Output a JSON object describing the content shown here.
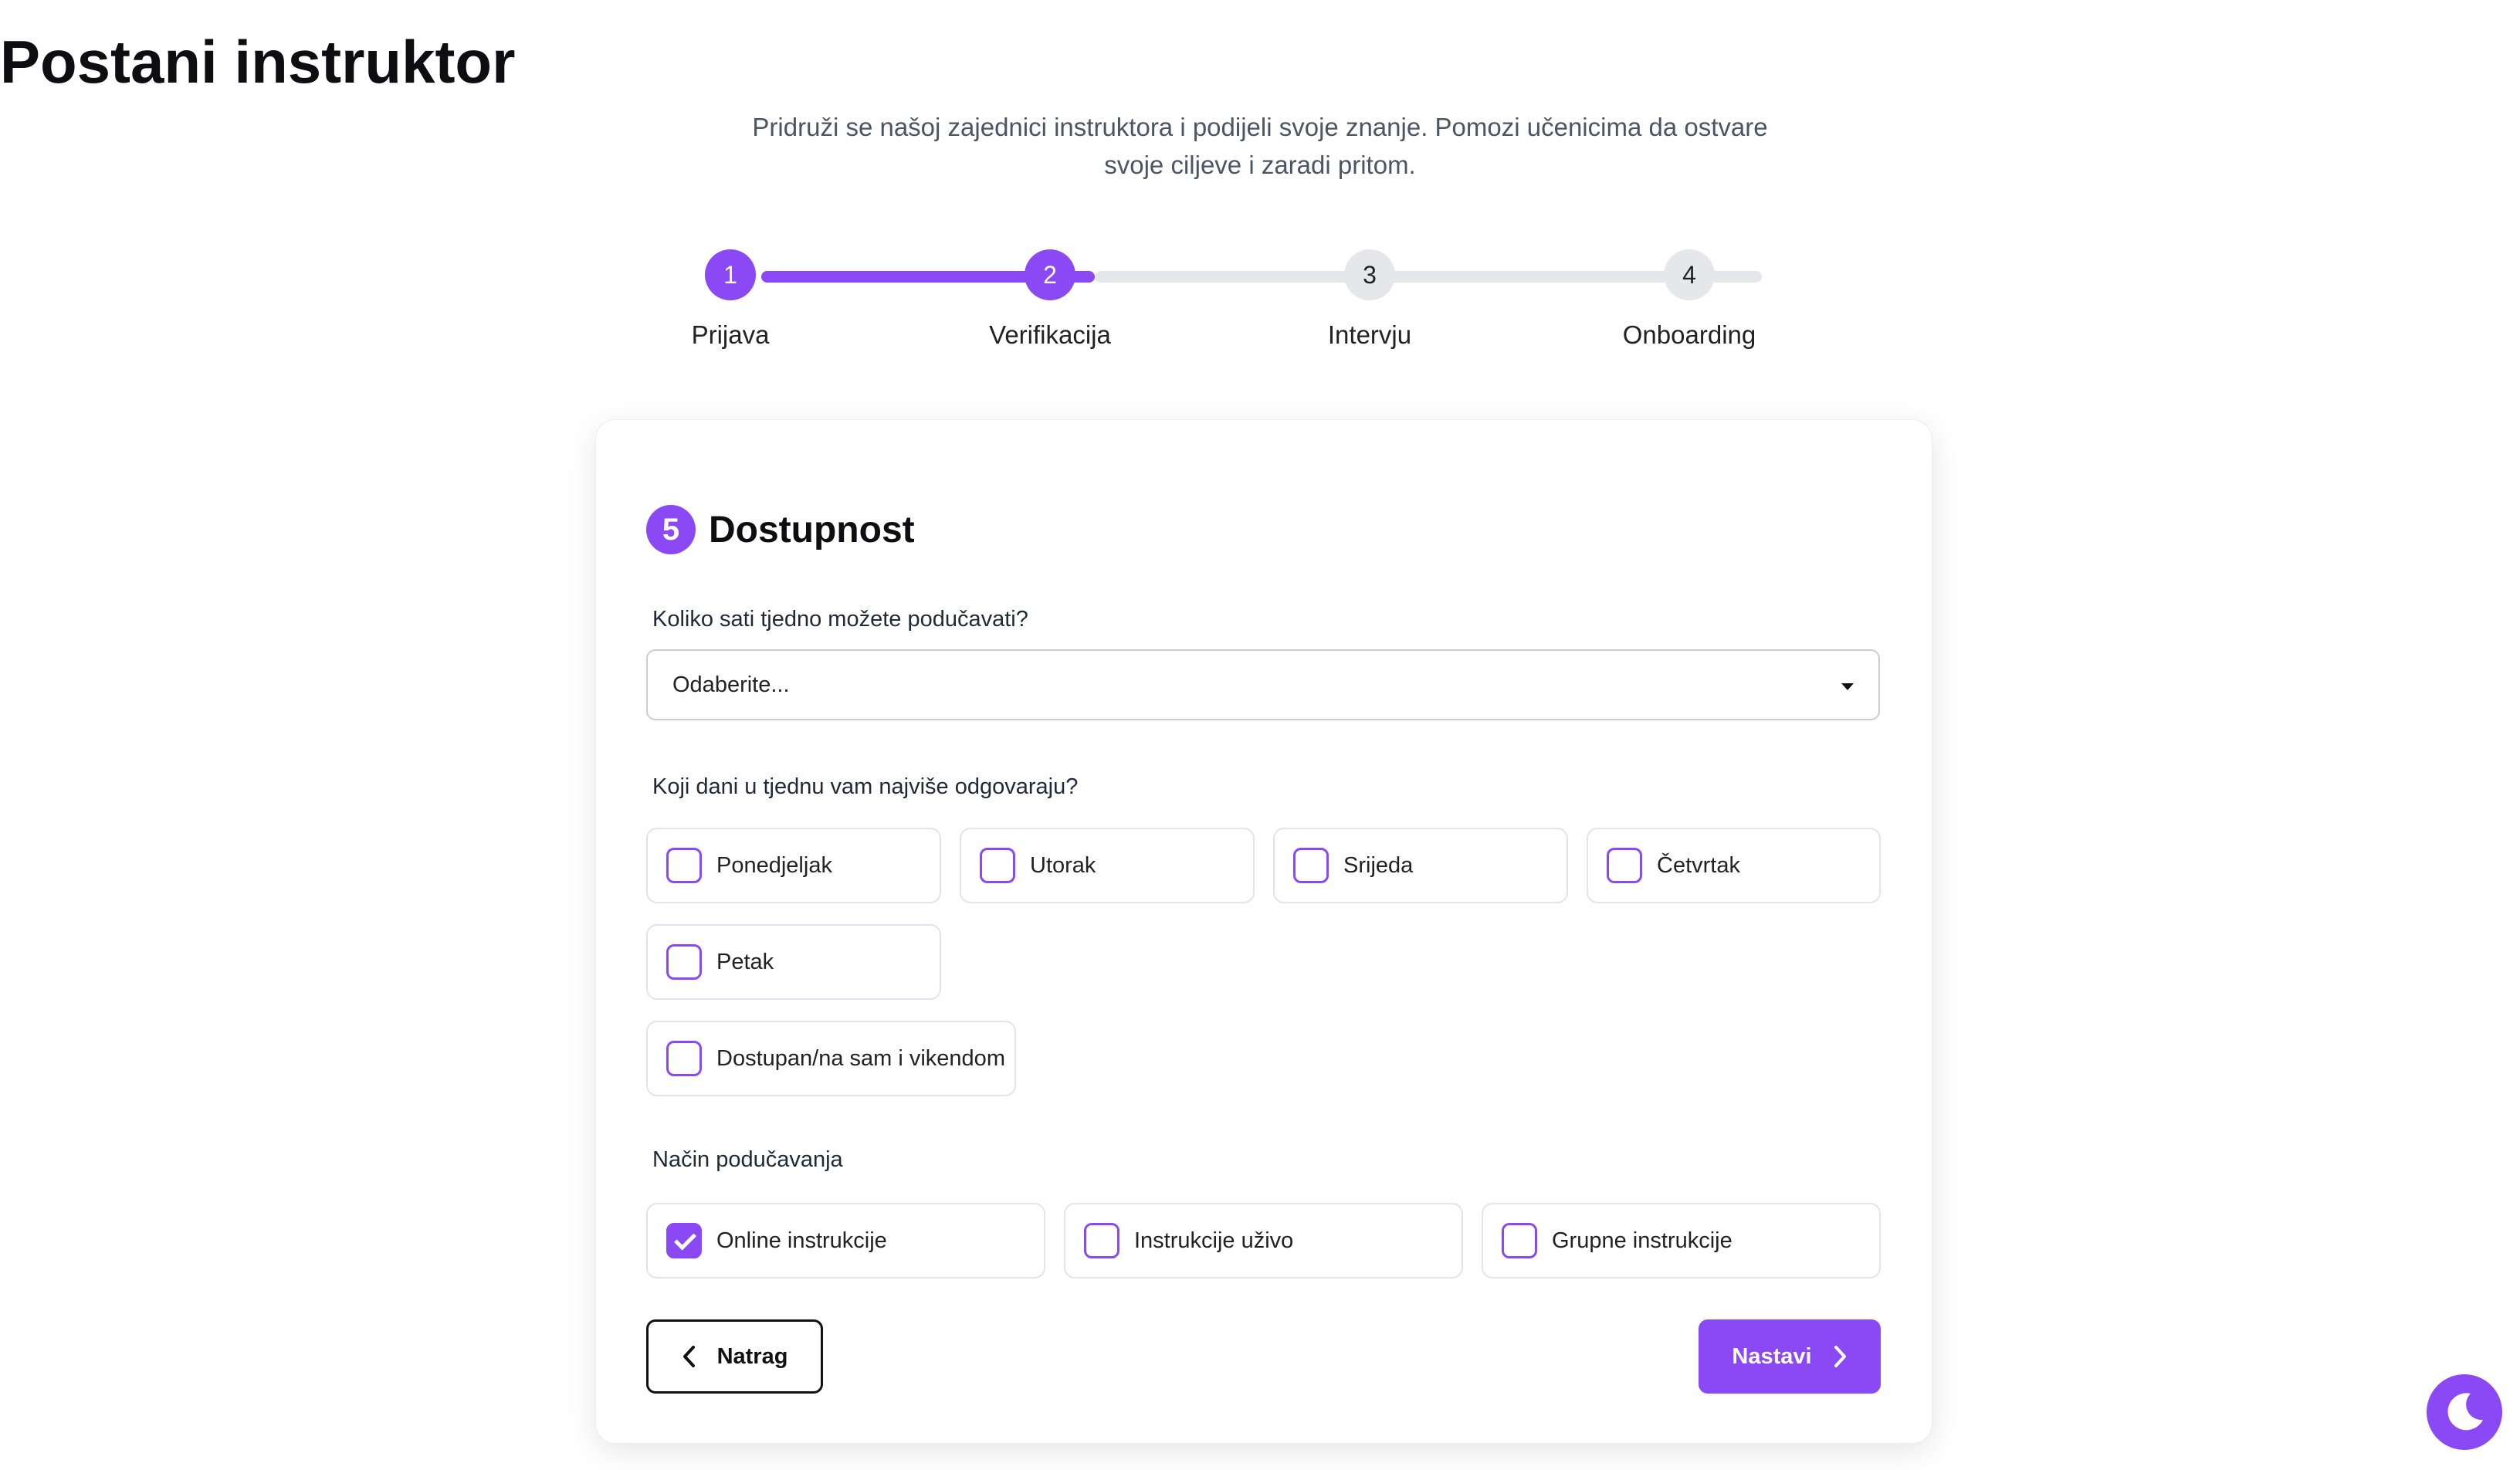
{
  "header": {
    "title": "Postani instruktor",
    "subtitle": "Pridruži se našoj zajednici instruktora i podijeli svoje znanje. Pomozi učenicima da ostvare svoje ciljeve i zaradi pritom."
  },
  "stepper": {
    "current_step": 2,
    "steps": [
      {
        "number": "1",
        "label": "Prijava",
        "status": "done"
      },
      {
        "number": "2",
        "label": "Verifikacija",
        "status": "active"
      },
      {
        "number": "3",
        "label": "Intervju",
        "status": "pending"
      },
      {
        "number": "4",
        "label": "Onboarding",
        "status": "pending"
      }
    ]
  },
  "form": {
    "section_number": "5",
    "section_title": "Dostupnost",
    "hours_question": "Koliko sati tjedno možete podučavati?",
    "hours_select_value": "Odaberite...",
    "days_question": "Koji dani u tjednu vam najviše odgovaraju?",
    "days": [
      {
        "label": "Ponedjeljak",
        "checked": false
      },
      {
        "label": "Utorak",
        "checked": false
      },
      {
        "label": "Srijeda",
        "checked": false
      },
      {
        "label": "Četvrtak",
        "checked": false
      },
      {
        "label": "Petak",
        "checked": false
      }
    ],
    "weekend_option": {
      "label": "Dostupan/na sam i vikendom",
      "checked": false
    },
    "mode_question": "Način podučavanja",
    "modes": [
      {
        "label": "Online instrukcije",
        "checked": true
      },
      {
        "label": "Instrukcije uživo",
        "checked": false
      },
      {
        "label": "Grupne instrukcije",
        "checked": false
      }
    ],
    "back_label": "Natrag",
    "next_label": "Nastavi"
  },
  "theme": {
    "accent": "#8b48f5",
    "toggle_icon": "moon-icon"
  }
}
